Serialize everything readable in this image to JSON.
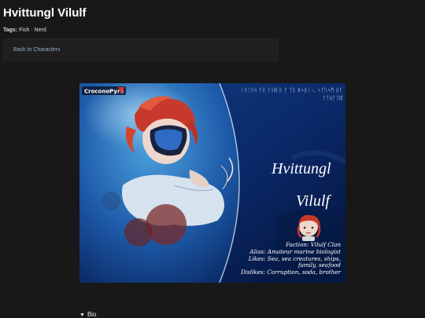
{
  "page": {
    "title": "Hvittungl Vilulf",
    "tags_label": "Tags:",
    "tags_value": "Fish · Nerd",
    "back_link": "Back to Characters"
  },
  "artwork": {
    "logo_text": "CroconoPyre",
    "rune_line_1": "ᛁᛋᛁᚢᛋ ᚨᚱ ᚨᚾᛞ ᚱ ᚨ ᛏᚱ ᚻᛃᛒᛁᚲ, ᛃᛏᚢᛃᛗ ᚺᚨ",
    "rune_line_2": "ᚨᛏᚺᚨᛚᛞ",
    "name_line_1": "Hvittungl",
    "name_line_2": "Vilulf",
    "faction": "Faction: Vilulf Clan",
    "alias": "Alias: Amateur marine biologist",
    "likes_1": "Likes: Sea, sea creatures, ships,",
    "likes_2": "family, seafood",
    "dislikes": "Dislikes: Corruption, soda, brother"
  },
  "bio": {
    "arrow": "▼",
    "label": "Bio"
  }
}
